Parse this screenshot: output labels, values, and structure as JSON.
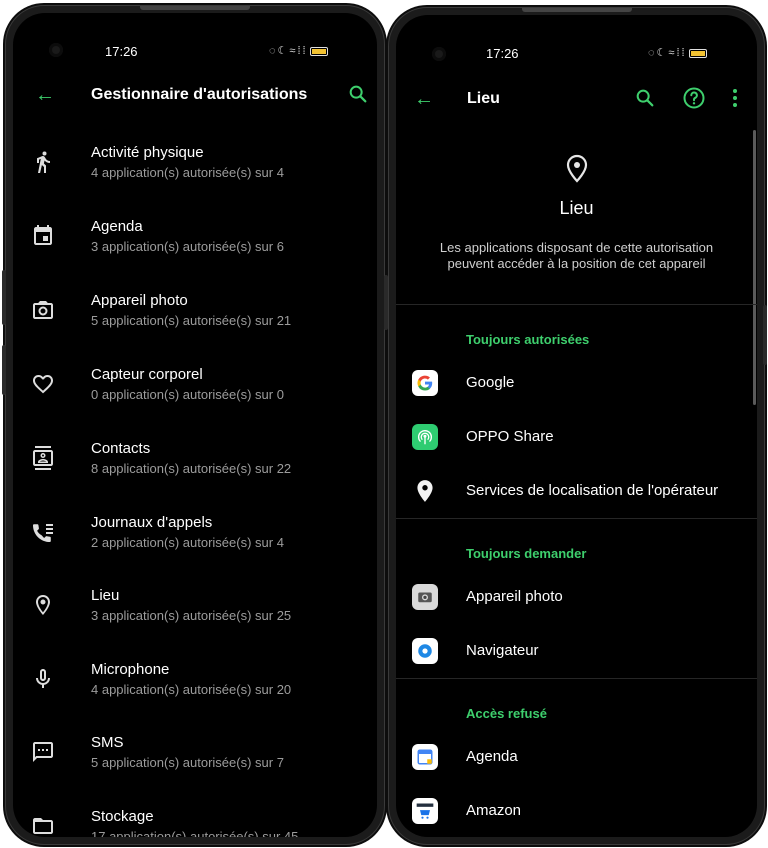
{
  "left": {
    "status": {
      "time": "17:26"
    },
    "appbar": {
      "title": "Gestionnaire d'autorisations"
    },
    "permissions": [
      {
        "name": "Activité physique",
        "summary": "4 application(s) autorisée(s) sur 4",
        "icon": "run-icon"
      },
      {
        "name": "Agenda",
        "summary": "3 application(s) autorisée(s) sur 6",
        "icon": "calendar-icon"
      },
      {
        "name": "Appareil photo",
        "summary": "5 application(s) autorisée(s) sur 21",
        "icon": "camera-icon"
      },
      {
        "name": "Capteur corporel",
        "summary": "0 application(s) autorisée(s) sur 0",
        "icon": "heart-icon"
      },
      {
        "name": "Contacts",
        "summary": "8 application(s) autorisée(s) sur 22",
        "icon": "contacts-icon"
      },
      {
        "name": "Journaux d'appels",
        "summary": "2 application(s) autorisée(s) sur 4",
        "icon": "call-log-icon"
      },
      {
        "name": "Lieu",
        "summary": "3 application(s) autorisée(s) sur 25",
        "icon": "location-icon"
      },
      {
        "name": "Microphone",
        "summary": "4 application(s) autorisée(s) sur 20",
        "icon": "microphone-icon"
      },
      {
        "name": "SMS",
        "summary": "5 application(s) autorisée(s) sur 7",
        "icon": "sms-icon"
      },
      {
        "name": "Stockage",
        "summary": "17 application(s) autorisée(s) sur 45",
        "icon": "folder-icon"
      }
    ]
  },
  "right": {
    "status": {
      "time": "17:26"
    },
    "appbar": {
      "title": "Lieu"
    },
    "hero": {
      "title": "Lieu",
      "description": "Les applications disposant de cette autorisation peuvent accéder à la position de cet appareil"
    },
    "sections": {
      "allowed": "Toujours autorisées",
      "ask": "Toujours demander",
      "denied": "Accès refusé"
    },
    "apps": {
      "allowed": [
        "Google",
        "OPPO Share",
        "Services de localisation de l'opérateur"
      ],
      "ask": [
        "Appareil photo",
        "Navigateur"
      ],
      "denied": [
        "Agenda",
        "Amazon"
      ]
    }
  },
  "colors": {
    "accent": "#3ecf6d",
    "background": "#000000",
    "secondary_text": "#9c9c9c"
  }
}
